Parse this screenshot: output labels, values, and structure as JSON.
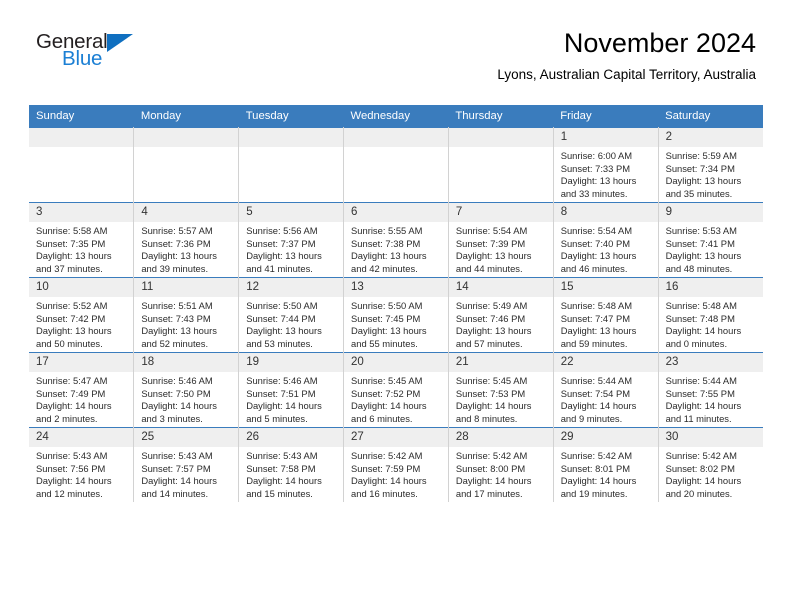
{
  "brand": {
    "name_part1": "General",
    "name_part2": "Blue",
    "accent_color": "#1b7fd4",
    "triangle_color": "#0f6fc0"
  },
  "header": {
    "month_title": "November 2024",
    "location": "Lyons, Australian Capital Territory, Australia",
    "header_bg_color": "#3a7cbd",
    "daynum_bg_color": "#efefef"
  },
  "weekdays": [
    "Sunday",
    "Monday",
    "Tuesday",
    "Wednesday",
    "Thursday",
    "Friday",
    "Saturday"
  ],
  "weeks": [
    [
      {
        "day": "",
        "empty": true
      },
      {
        "day": "",
        "empty": true
      },
      {
        "day": "",
        "empty": true
      },
      {
        "day": "",
        "empty": true
      },
      {
        "day": "",
        "empty": true
      },
      {
        "day": "1",
        "sunrise": "Sunrise: 6:00 AM",
        "sunset": "Sunset: 7:33 PM",
        "daylight": "Daylight: 13 hours and 33 minutes."
      },
      {
        "day": "2",
        "sunrise": "Sunrise: 5:59 AM",
        "sunset": "Sunset: 7:34 PM",
        "daylight": "Daylight: 13 hours and 35 minutes."
      }
    ],
    [
      {
        "day": "3",
        "sunrise": "Sunrise: 5:58 AM",
        "sunset": "Sunset: 7:35 PM",
        "daylight": "Daylight: 13 hours and 37 minutes."
      },
      {
        "day": "4",
        "sunrise": "Sunrise: 5:57 AM",
        "sunset": "Sunset: 7:36 PM",
        "daylight": "Daylight: 13 hours and 39 minutes."
      },
      {
        "day": "5",
        "sunrise": "Sunrise: 5:56 AM",
        "sunset": "Sunset: 7:37 PM",
        "daylight": "Daylight: 13 hours and 41 minutes."
      },
      {
        "day": "6",
        "sunrise": "Sunrise: 5:55 AM",
        "sunset": "Sunset: 7:38 PM",
        "daylight": "Daylight: 13 hours and 42 minutes."
      },
      {
        "day": "7",
        "sunrise": "Sunrise: 5:54 AM",
        "sunset": "Sunset: 7:39 PM",
        "daylight": "Daylight: 13 hours and 44 minutes."
      },
      {
        "day": "8",
        "sunrise": "Sunrise: 5:54 AM",
        "sunset": "Sunset: 7:40 PM",
        "daylight": "Daylight: 13 hours and 46 minutes."
      },
      {
        "day": "9",
        "sunrise": "Sunrise: 5:53 AM",
        "sunset": "Sunset: 7:41 PM",
        "daylight": "Daylight: 13 hours and 48 minutes."
      }
    ],
    [
      {
        "day": "10",
        "sunrise": "Sunrise: 5:52 AM",
        "sunset": "Sunset: 7:42 PM",
        "daylight": "Daylight: 13 hours and 50 minutes."
      },
      {
        "day": "11",
        "sunrise": "Sunrise: 5:51 AM",
        "sunset": "Sunset: 7:43 PM",
        "daylight": "Daylight: 13 hours and 52 minutes."
      },
      {
        "day": "12",
        "sunrise": "Sunrise: 5:50 AM",
        "sunset": "Sunset: 7:44 PM",
        "daylight": "Daylight: 13 hours and 53 minutes."
      },
      {
        "day": "13",
        "sunrise": "Sunrise: 5:50 AM",
        "sunset": "Sunset: 7:45 PM",
        "daylight": "Daylight: 13 hours and 55 minutes."
      },
      {
        "day": "14",
        "sunrise": "Sunrise: 5:49 AM",
        "sunset": "Sunset: 7:46 PM",
        "daylight": "Daylight: 13 hours and 57 minutes."
      },
      {
        "day": "15",
        "sunrise": "Sunrise: 5:48 AM",
        "sunset": "Sunset: 7:47 PM",
        "daylight": "Daylight: 13 hours and 59 minutes."
      },
      {
        "day": "16",
        "sunrise": "Sunrise: 5:48 AM",
        "sunset": "Sunset: 7:48 PM",
        "daylight": "Daylight: 14 hours and 0 minutes."
      }
    ],
    [
      {
        "day": "17",
        "sunrise": "Sunrise: 5:47 AM",
        "sunset": "Sunset: 7:49 PM",
        "daylight": "Daylight: 14 hours and 2 minutes."
      },
      {
        "day": "18",
        "sunrise": "Sunrise: 5:46 AM",
        "sunset": "Sunset: 7:50 PM",
        "daylight": "Daylight: 14 hours and 3 minutes."
      },
      {
        "day": "19",
        "sunrise": "Sunrise: 5:46 AM",
        "sunset": "Sunset: 7:51 PM",
        "daylight": "Daylight: 14 hours and 5 minutes."
      },
      {
        "day": "20",
        "sunrise": "Sunrise: 5:45 AM",
        "sunset": "Sunset: 7:52 PM",
        "daylight": "Daylight: 14 hours and 6 minutes."
      },
      {
        "day": "21",
        "sunrise": "Sunrise: 5:45 AM",
        "sunset": "Sunset: 7:53 PM",
        "daylight": "Daylight: 14 hours and 8 minutes."
      },
      {
        "day": "22",
        "sunrise": "Sunrise: 5:44 AM",
        "sunset": "Sunset: 7:54 PM",
        "daylight": "Daylight: 14 hours and 9 minutes."
      },
      {
        "day": "23",
        "sunrise": "Sunrise: 5:44 AM",
        "sunset": "Sunset: 7:55 PM",
        "daylight": "Daylight: 14 hours and 11 minutes."
      }
    ],
    [
      {
        "day": "24",
        "sunrise": "Sunrise: 5:43 AM",
        "sunset": "Sunset: 7:56 PM",
        "daylight": "Daylight: 14 hours and 12 minutes."
      },
      {
        "day": "25",
        "sunrise": "Sunrise: 5:43 AM",
        "sunset": "Sunset: 7:57 PM",
        "daylight": "Daylight: 14 hours and 14 minutes."
      },
      {
        "day": "26",
        "sunrise": "Sunrise: 5:43 AM",
        "sunset": "Sunset: 7:58 PM",
        "daylight": "Daylight: 14 hours and 15 minutes."
      },
      {
        "day": "27",
        "sunrise": "Sunrise: 5:42 AM",
        "sunset": "Sunset: 7:59 PM",
        "daylight": "Daylight: 14 hours and 16 minutes."
      },
      {
        "day": "28",
        "sunrise": "Sunrise: 5:42 AM",
        "sunset": "Sunset: 8:00 PM",
        "daylight": "Daylight: 14 hours and 17 minutes."
      },
      {
        "day": "29",
        "sunrise": "Sunrise: 5:42 AM",
        "sunset": "Sunset: 8:01 PM",
        "daylight": "Daylight: 14 hours and 19 minutes."
      },
      {
        "day": "30",
        "sunrise": "Sunrise: 5:42 AM",
        "sunset": "Sunset: 8:02 PM",
        "daylight": "Daylight: 14 hours and 20 minutes."
      }
    ]
  ]
}
